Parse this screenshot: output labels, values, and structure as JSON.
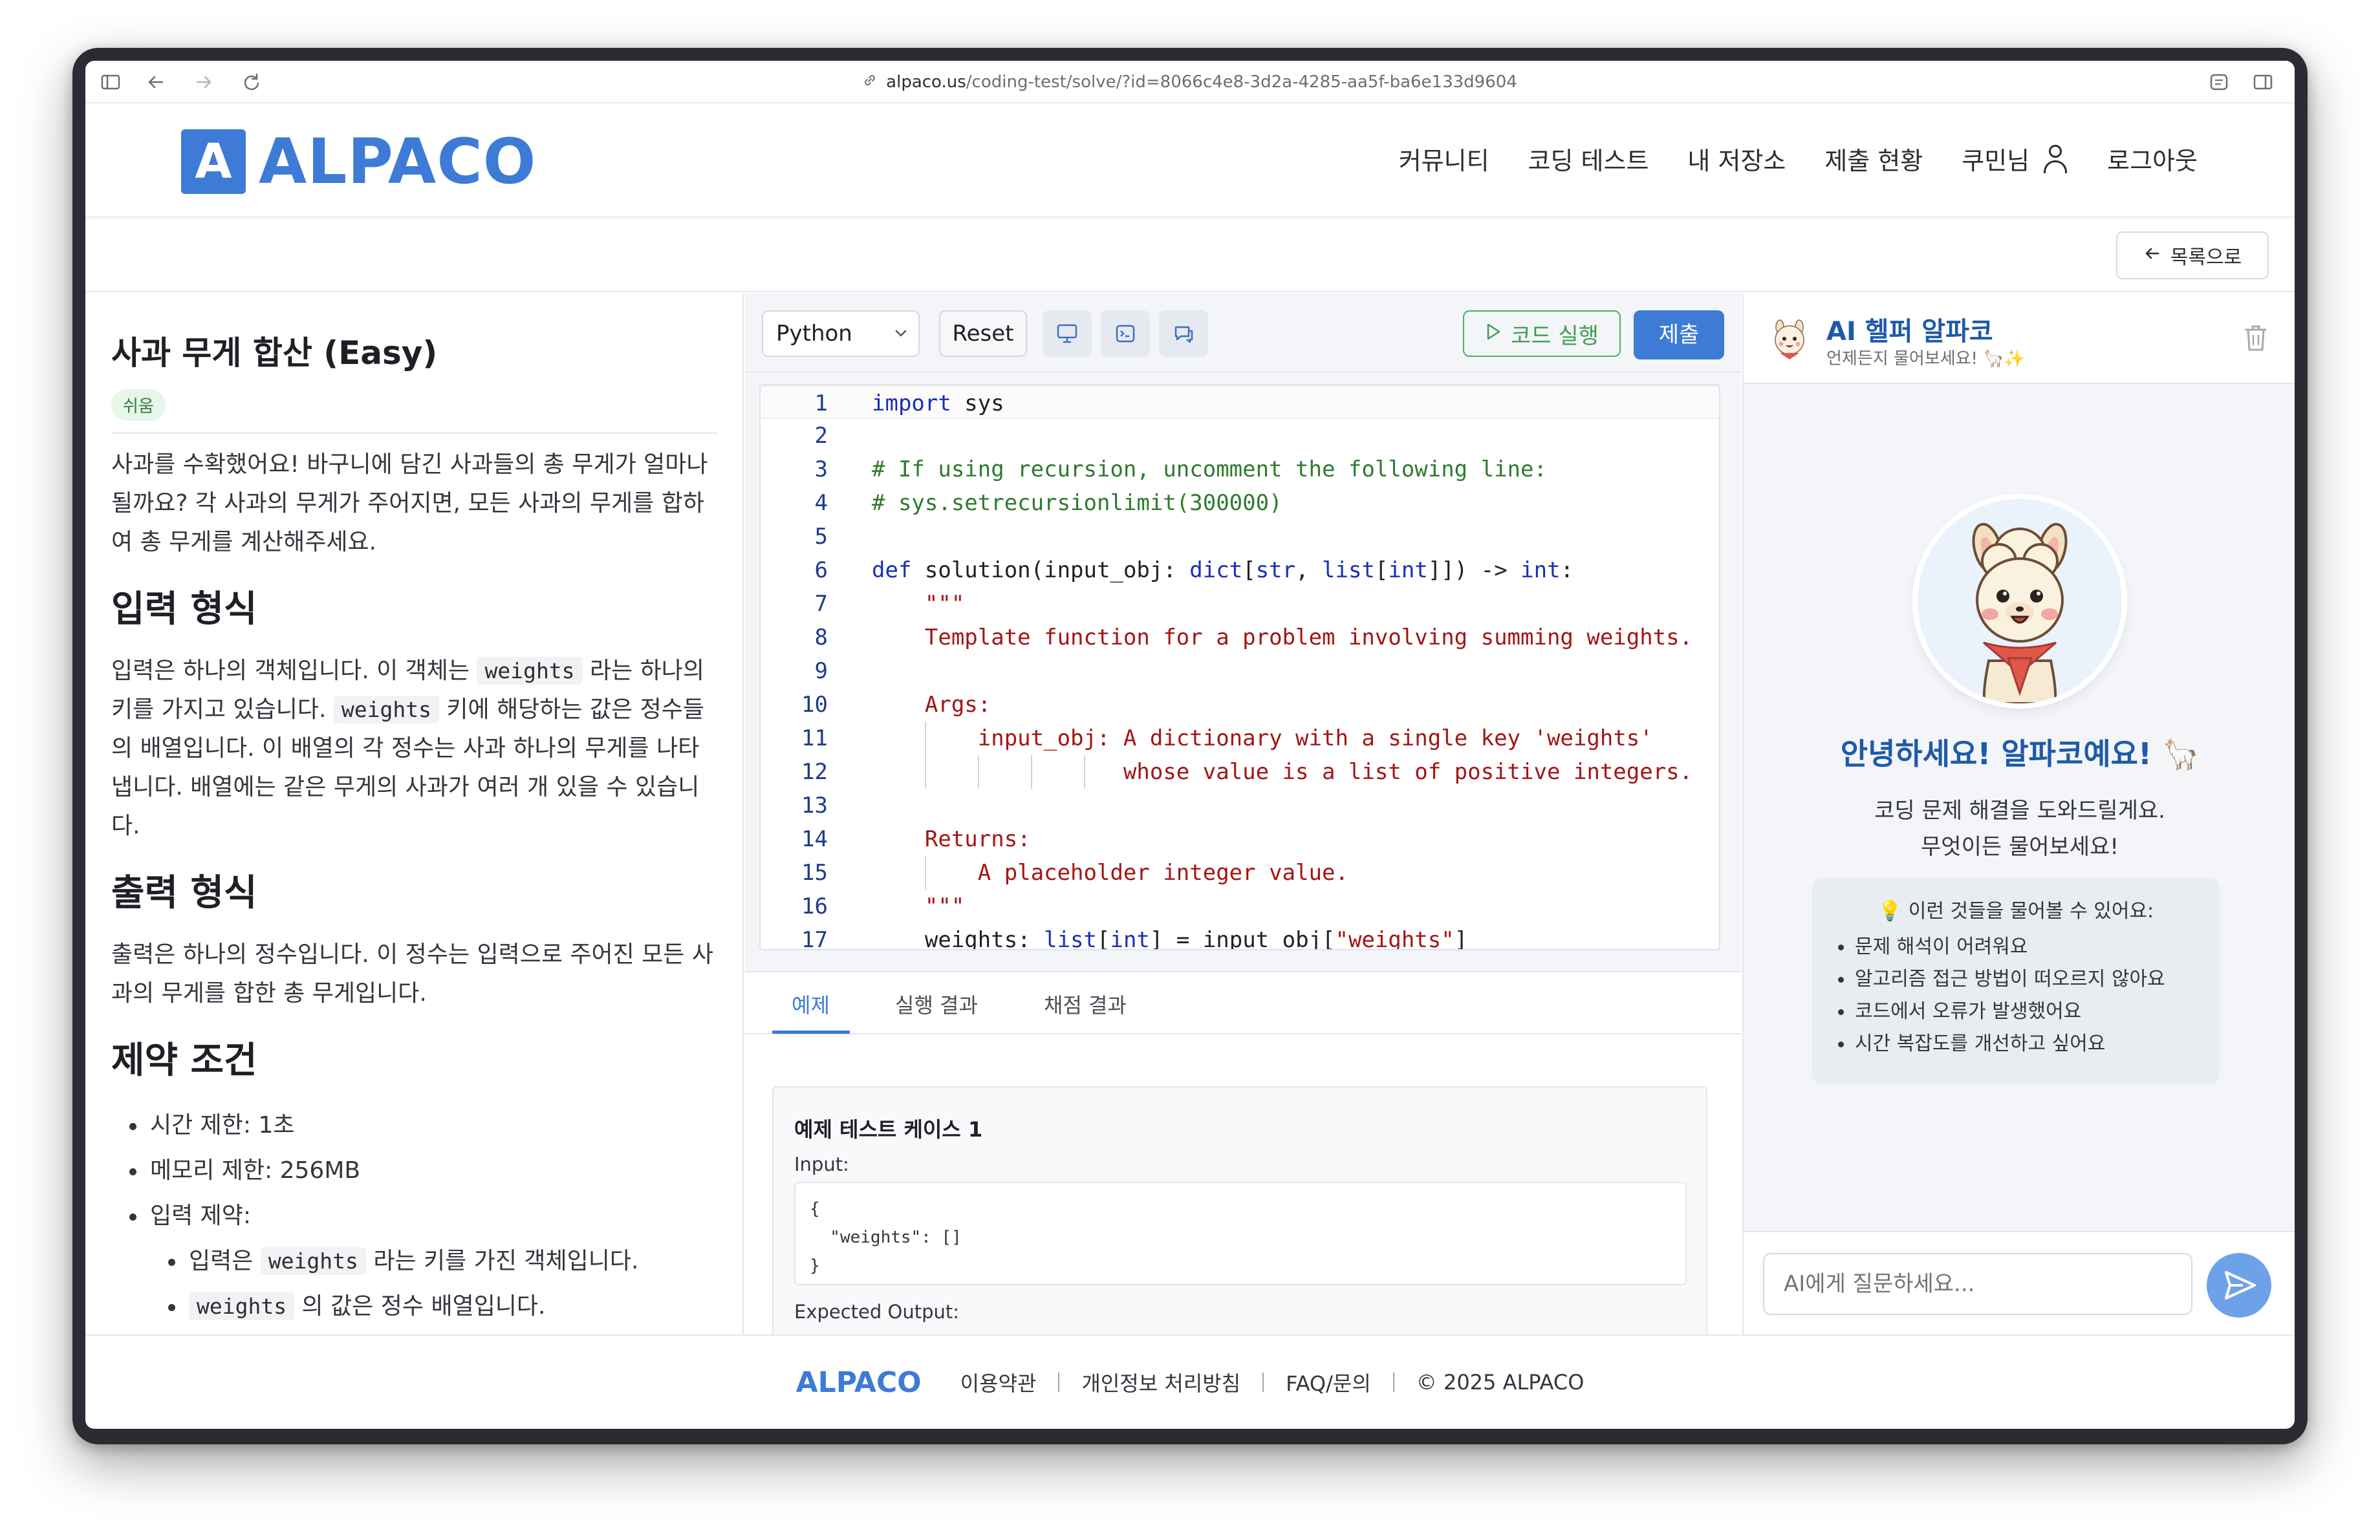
{
  "browser": {
    "url_host": "alpaco.us",
    "url_path": "/coding-test/solve/?id=8066c4e8-3d2a-4285-aa5f-ba6e133d9604"
  },
  "header": {
    "logo_text": "ALPACO",
    "logo_letter": "A",
    "nav": [
      "커뮤니티",
      "코딩 테스트",
      "내 저장소",
      "제출 현황"
    ],
    "user_name": "쿠민님",
    "logout": "로그아웃",
    "back_label": "목록으로"
  },
  "problem": {
    "title": "사과 무게 합산 (Easy)",
    "difficulty": "쉬움",
    "intro": "사과를 수확했어요! 바구니에 담긴 사과들의 총 무게가 얼마나 될까요? 각 사과의 무게가 주어지면, 모든 사과의 무게를 합하여 총 무게를 계산해주세요.",
    "input_heading": "입력 형식",
    "input_p1": "입력은 하나의 객체입니다. 이 객체는 ",
    "input_code1": "weights",
    "input_p2": " 라는 하나의 키를 가지고 있습니다. ",
    "input_code2": "weights",
    "input_p3": " 키에 해당하는 값은 정수들의 배열입니다. 이 배열의 각 정수는 사과 하나의 무게를 나타냅니다. 배열에는 같은 무게의 사과가 여러 개 있을 수 있습니다.",
    "output_heading": "출력 형식",
    "output_text": "출력은 하나의 정수입니다. 이 정수는 입력으로 주어진 모든 사과의 무게를 합한 총 무게입니다.",
    "constraints_heading": "제약 조건",
    "constraints": [
      "시간 제한: 1초",
      "메모리 제한: 256MB",
      "입력 제약:"
    ],
    "sub1_code": "weights",
    "sub1_pre": "입력은 ",
    "sub1_post": " 라는 키를 가진 객체입니다.",
    "sub2_code": "weights",
    "sub2_post": " 의 값은 정수 배열입니다."
  },
  "editor": {
    "language": "Python",
    "reset": "Reset",
    "run": "코드 실행",
    "submit": "제출",
    "line_numbers": [
      "1",
      "2",
      "3",
      "4",
      "5",
      "6",
      "7",
      "8",
      "9",
      "10",
      "11",
      "12",
      "13",
      "14",
      "15",
      "16",
      "17"
    ],
    "code": [
      "import sys",
      "",
      "# If using recursion, uncomment the following line:",
      "# sys.setrecursionlimit(300000)",
      "",
      "def solution(input_obj: dict[str, list[int]]) -> int:",
      "    \"\"\"",
      "    Template function for a problem involving summing weights.",
      "",
      "    Args:",
      "        input_obj: A dictionary with a single key 'weights'",
      "                   whose value is a list of positive integers.",
      "",
      "    Returns:",
      "        A placeholder integer value.",
      "    \"\"\"",
      "    weights: list[int] = input_obj[\"weights\"]"
    ],
    "tabs": [
      "예제",
      "실행 결과",
      "채점 결과"
    ],
    "case_title": "예제 테스트 케이스 1",
    "input_label": "Input:",
    "input_value": "{\n  \"weights\": []\n}",
    "expected_label": "Expected Output:"
  },
  "ai": {
    "title": "AI 헬퍼 알파코",
    "subtitle": "언제든지 물어보세요! 🦙✨",
    "hello": "안녕하세요! 알파코예요! 🦙",
    "desc1": "코딩 문제 해결을 도와드릴게요.",
    "desc2": "무엇이든 물어보세요!",
    "tips_head": "💡 이런 것들을 물어볼 수 있어요:",
    "tips": [
      "문제 해석이 어려워요",
      "알고리즘 접근 방법이 떠오르지 않아요",
      "코드에서 오류가 발생했어요",
      "시간 복잡도를 개선하고 싶어요"
    ],
    "input_placeholder": "AI에게 질문하세요..."
  },
  "footer": {
    "logo": "ALPACO",
    "links": [
      "이용약관",
      "개인정보 처리방침",
      "FAQ/문의",
      "© 2025 ALPACO"
    ]
  },
  "colors": {
    "brand": "#3d7bd6",
    "run_green": "#3e9d52",
    "ai_title": "#1f5aa8"
  }
}
